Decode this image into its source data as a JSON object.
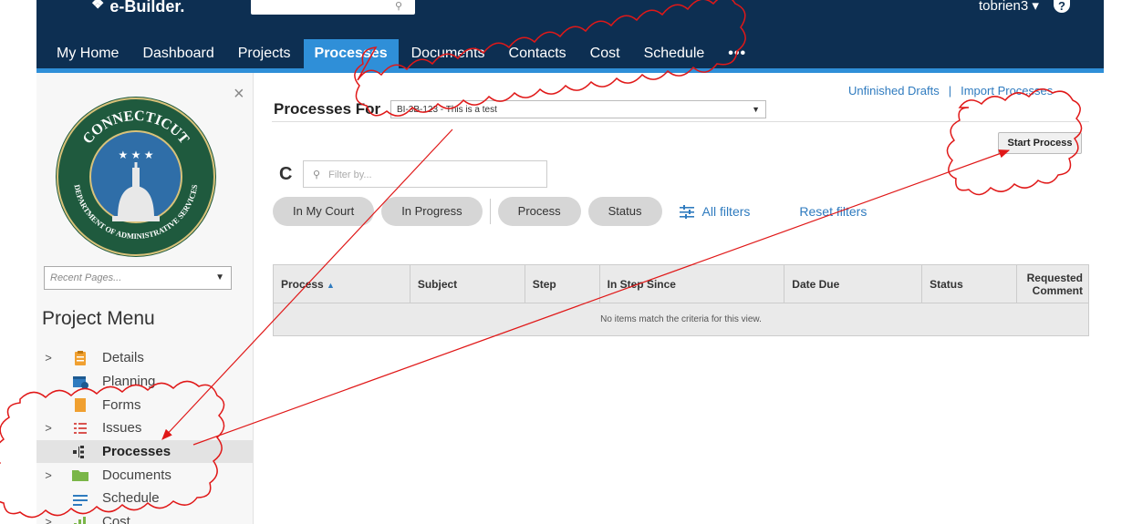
{
  "app": {
    "logo_text": "e-Builder.",
    "user": "tobrien3 ▾",
    "help": "?"
  },
  "nav": {
    "tabs": [
      "My Home",
      "Dashboard",
      "Projects",
      "Processes",
      "Documents",
      "Contacts",
      "Cost",
      "Schedule",
      "•••"
    ],
    "active": "Processes"
  },
  "sidebar": {
    "close": "×",
    "recent_pages_placeholder": "Recent Pages...",
    "project_menu_title": "Project Menu",
    "seal_text_top": "CONNECTICUT",
    "seal_text_bottom": "DEPARTMENT OF ADMINISTRATIVE SERVICES",
    "items": [
      {
        "label": "Details",
        "chevron": true,
        "icon": "clipboard-icon",
        "color": "#f0a030"
      },
      {
        "label": "Planning",
        "chevron": false,
        "icon": "calendar-icon",
        "color": "#2f7bbf"
      },
      {
        "label": "Forms",
        "chevron": false,
        "icon": "forms-icon",
        "color": "#f0a030"
      },
      {
        "label": "Issues",
        "chevron": true,
        "icon": "issues-list-icon",
        "color": "#d9534f"
      },
      {
        "label": "Processes",
        "chevron": false,
        "icon": "process-tree-icon",
        "color": "#333333",
        "active": true
      },
      {
        "label": "Documents",
        "chevron": true,
        "icon": "folder-icon",
        "color": "#7ab648"
      },
      {
        "label": "Schedule",
        "chevron": false,
        "icon": "schedule-icon",
        "color": "#2f7bbf"
      },
      {
        "label": "Cost",
        "chevron": true,
        "icon": "cost-chart-icon",
        "color": "#7ab648"
      }
    ]
  },
  "main": {
    "links": {
      "unfinished": "Unfinished Drafts",
      "sep": "|",
      "import": "Import Processes"
    },
    "processes_for_label": "Processes For",
    "project_select": "BI-3B-123 - This is a test",
    "start_process": "Start Process",
    "filter_placeholder": "Filter by...",
    "chips": [
      "In My Court",
      "In Progress",
      "Process",
      "Status"
    ],
    "all_filters": "All filters",
    "reset_filters": "Reset filters",
    "table": {
      "columns": [
        "Process",
        "Subject",
        "Step",
        "In Step Since",
        "Date Due",
        "Status",
        "Requested Comment"
      ],
      "sort_indicator": "▲",
      "empty": "No items match the criteria for this view."
    }
  },
  "colors": {
    "nav_bg": "#0d2f52",
    "nav_active": "#2f8fd8",
    "link": "#2f7bbf",
    "annotation": "#e01818"
  }
}
